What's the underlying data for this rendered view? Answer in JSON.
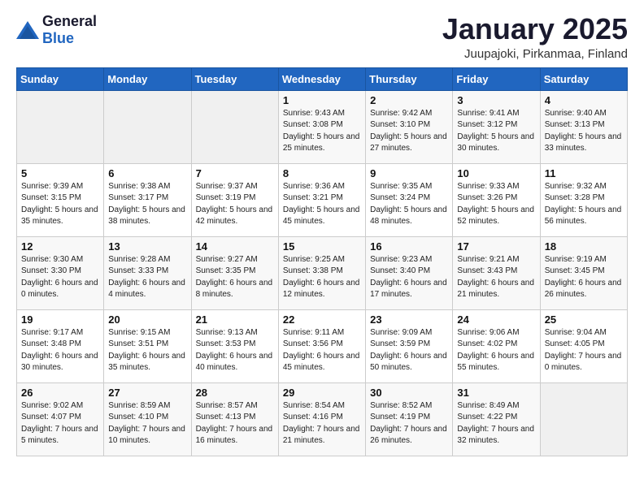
{
  "header": {
    "logo_general": "General",
    "logo_blue": "Blue",
    "title": "January 2025",
    "subtitle": "Juupajoki, Pirkanmaa, Finland"
  },
  "weekdays": [
    "Sunday",
    "Monday",
    "Tuesday",
    "Wednesday",
    "Thursday",
    "Friday",
    "Saturday"
  ],
  "weeks": [
    [
      {
        "day": "",
        "info": ""
      },
      {
        "day": "",
        "info": ""
      },
      {
        "day": "",
        "info": ""
      },
      {
        "day": "1",
        "info": "Sunrise: 9:43 AM\nSunset: 3:08 PM\nDaylight: 5 hours and 25 minutes."
      },
      {
        "day": "2",
        "info": "Sunrise: 9:42 AM\nSunset: 3:10 PM\nDaylight: 5 hours and 27 minutes."
      },
      {
        "day": "3",
        "info": "Sunrise: 9:41 AM\nSunset: 3:12 PM\nDaylight: 5 hours and 30 minutes."
      },
      {
        "day": "4",
        "info": "Sunrise: 9:40 AM\nSunset: 3:13 PM\nDaylight: 5 hours and 33 minutes."
      }
    ],
    [
      {
        "day": "5",
        "info": "Sunrise: 9:39 AM\nSunset: 3:15 PM\nDaylight: 5 hours and 35 minutes."
      },
      {
        "day": "6",
        "info": "Sunrise: 9:38 AM\nSunset: 3:17 PM\nDaylight: 5 hours and 38 minutes."
      },
      {
        "day": "7",
        "info": "Sunrise: 9:37 AM\nSunset: 3:19 PM\nDaylight: 5 hours and 42 minutes."
      },
      {
        "day": "8",
        "info": "Sunrise: 9:36 AM\nSunset: 3:21 PM\nDaylight: 5 hours and 45 minutes."
      },
      {
        "day": "9",
        "info": "Sunrise: 9:35 AM\nSunset: 3:24 PM\nDaylight: 5 hours and 48 minutes."
      },
      {
        "day": "10",
        "info": "Sunrise: 9:33 AM\nSunset: 3:26 PM\nDaylight: 5 hours and 52 minutes."
      },
      {
        "day": "11",
        "info": "Sunrise: 9:32 AM\nSunset: 3:28 PM\nDaylight: 5 hours and 56 minutes."
      }
    ],
    [
      {
        "day": "12",
        "info": "Sunrise: 9:30 AM\nSunset: 3:30 PM\nDaylight: 6 hours and 0 minutes."
      },
      {
        "day": "13",
        "info": "Sunrise: 9:28 AM\nSunset: 3:33 PM\nDaylight: 6 hours and 4 minutes."
      },
      {
        "day": "14",
        "info": "Sunrise: 9:27 AM\nSunset: 3:35 PM\nDaylight: 6 hours and 8 minutes."
      },
      {
        "day": "15",
        "info": "Sunrise: 9:25 AM\nSunset: 3:38 PM\nDaylight: 6 hours and 12 minutes."
      },
      {
        "day": "16",
        "info": "Sunrise: 9:23 AM\nSunset: 3:40 PM\nDaylight: 6 hours and 17 minutes."
      },
      {
        "day": "17",
        "info": "Sunrise: 9:21 AM\nSunset: 3:43 PM\nDaylight: 6 hours and 21 minutes."
      },
      {
        "day": "18",
        "info": "Sunrise: 9:19 AM\nSunset: 3:45 PM\nDaylight: 6 hours and 26 minutes."
      }
    ],
    [
      {
        "day": "19",
        "info": "Sunrise: 9:17 AM\nSunset: 3:48 PM\nDaylight: 6 hours and 30 minutes."
      },
      {
        "day": "20",
        "info": "Sunrise: 9:15 AM\nSunset: 3:51 PM\nDaylight: 6 hours and 35 minutes."
      },
      {
        "day": "21",
        "info": "Sunrise: 9:13 AM\nSunset: 3:53 PM\nDaylight: 6 hours and 40 minutes."
      },
      {
        "day": "22",
        "info": "Sunrise: 9:11 AM\nSunset: 3:56 PM\nDaylight: 6 hours and 45 minutes."
      },
      {
        "day": "23",
        "info": "Sunrise: 9:09 AM\nSunset: 3:59 PM\nDaylight: 6 hours and 50 minutes."
      },
      {
        "day": "24",
        "info": "Sunrise: 9:06 AM\nSunset: 4:02 PM\nDaylight: 6 hours and 55 minutes."
      },
      {
        "day": "25",
        "info": "Sunrise: 9:04 AM\nSunset: 4:05 PM\nDaylight: 7 hours and 0 minutes."
      }
    ],
    [
      {
        "day": "26",
        "info": "Sunrise: 9:02 AM\nSunset: 4:07 PM\nDaylight: 7 hours and 5 minutes."
      },
      {
        "day": "27",
        "info": "Sunrise: 8:59 AM\nSunset: 4:10 PM\nDaylight: 7 hours and 10 minutes."
      },
      {
        "day": "28",
        "info": "Sunrise: 8:57 AM\nSunset: 4:13 PM\nDaylight: 7 hours and 16 minutes."
      },
      {
        "day": "29",
        "info": "Sunrise: 8:54 AM\nSunset: 4:16 PM\nDaylight: 7 hours and 21 minutes."
      },
      {
        "day": "30",
        "info": "Sunrise: 8:52 AM\nSunset: 4:19 PM\nDaylight: 7 hours and 26 minutes."
      },
      {
        "day": "31",
        "info": "Sunrise: 8:49 AM\nSunset: 4:22 PM\nDaylight: 7 hours and 32 minutes."
      },
      {
        "day": "",
        "info": ""
      }
    ]
  ]
}
